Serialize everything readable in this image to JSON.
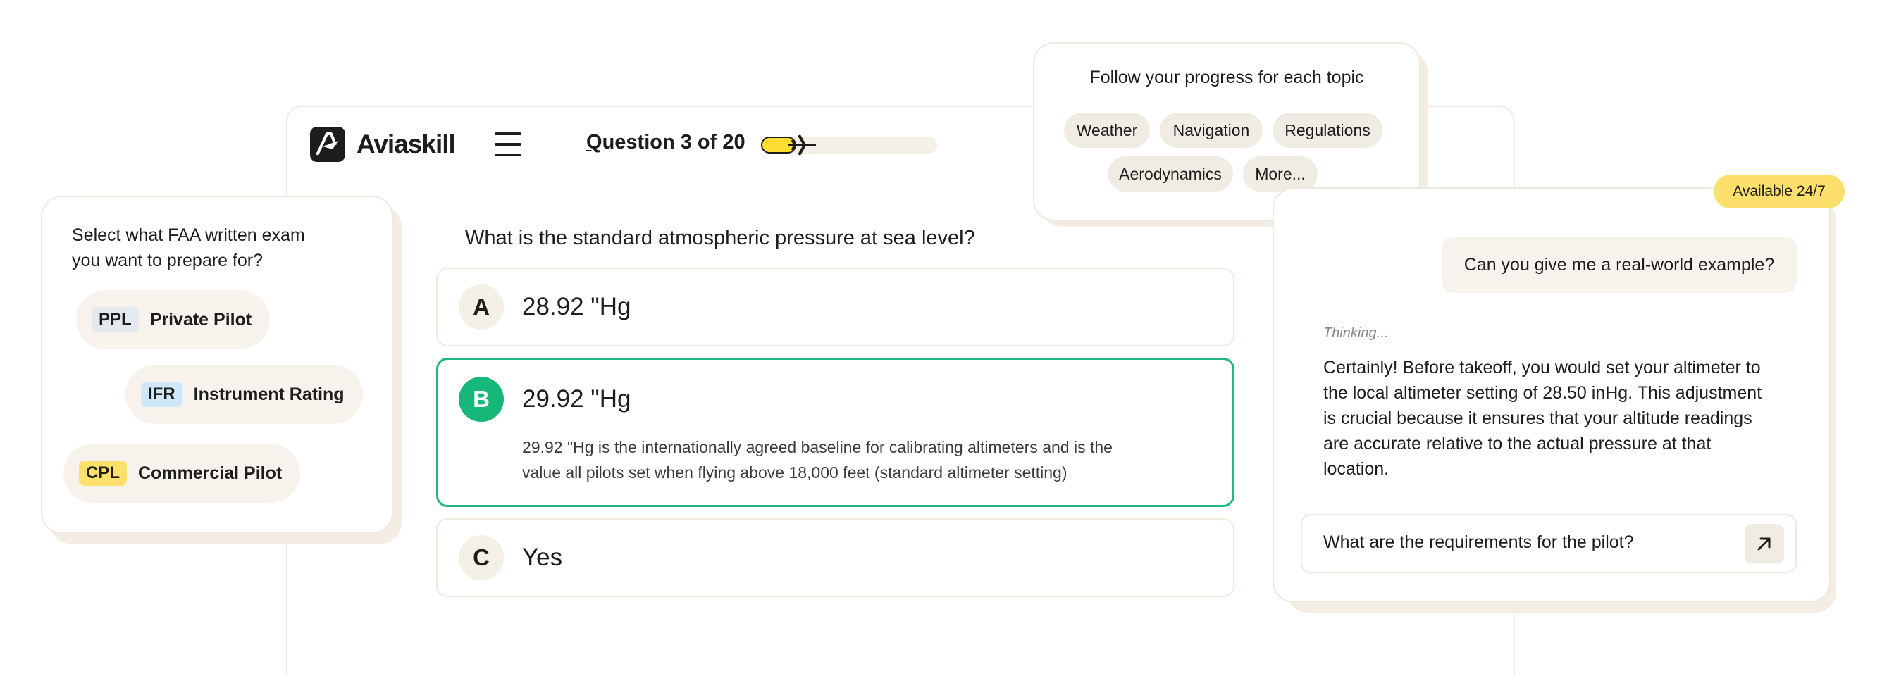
{
  "app": {
    "name": "Aviaskill"
  },
  "quiz": {
    "counter_q": "Q",
    "counter_rest": "uestion 3 of 20",
    "progress": 0.2,
    "question": "What is the standard atmospheric pressure at sea level?",
    "answers": [
      {
        "letter": "A",
        "text": "28.92 \"Hg"
      },
      {
        "letter": "B",
        "text": "29.92 \"Hg",
        "correct": true,
        "explanation": "29.92 \"Hg is the internationally agreed baseline for calibrating altimeters and is the value all pilots set when flying above 18,000 feet (standard altimeter setting)"
      },
      {
        "letter": "C",
        "text": "Yes"
      }
    ]
  },
  "exam_select": {
    "title_line1": "Select what FAA written exam",
    "title_line2": "you want to prepare for?",
    "options": [
      {
        "abbr": "PPL",
        "name": "Private Pilot"
      },
      {
        "abbr": "IFR",
        "name": "Instrument Rating"
      },
      {
        "abbr": "CPL",
        "name": "Commercial Pilot"
      }
    ]
  },
  "topics": {
    "title": "Follow your progress for each topic",
    "items": [
      "Weather",
      "Navigation",
      "Regulations",
      "Aerodynamics",
      "More..."
    ]
  },
  "chat": {
    "badge": "Available 24/7",
    "user_message": "Can you give me a real-world example?",
    "thinking": "Thinking...",
    "bot_lines": [
      "Certainly! Before takeoff, you would set your altimeter to",
      "the local altimeter setting of 28.50 inHg. This adjustment",
      "is crucial because it ensures that your altitude readings",
      "are accurate relative to the actual pressure at that",
      "location."
    ],
    "input_value": "What are the requirements for the pilot?"
  },
  "colors": {
    "accent_green": "#16b879",
    "accent_yellow": "#fddd33",
    "badge_yellow": "#fddf6b",
    "chip_bg": "#f7f3ec",
    "ppl_tag": "#e4e9ef",
    "ifr_tag": "#cfe7f8",
    "cpl_tag": "#fddf6b"
  },
  "icons": [
    "menu-icon",
    "airplane-icon",
    "arrow-up-right-icon",
    "aviaskill-logo-icon"
  ]
}
